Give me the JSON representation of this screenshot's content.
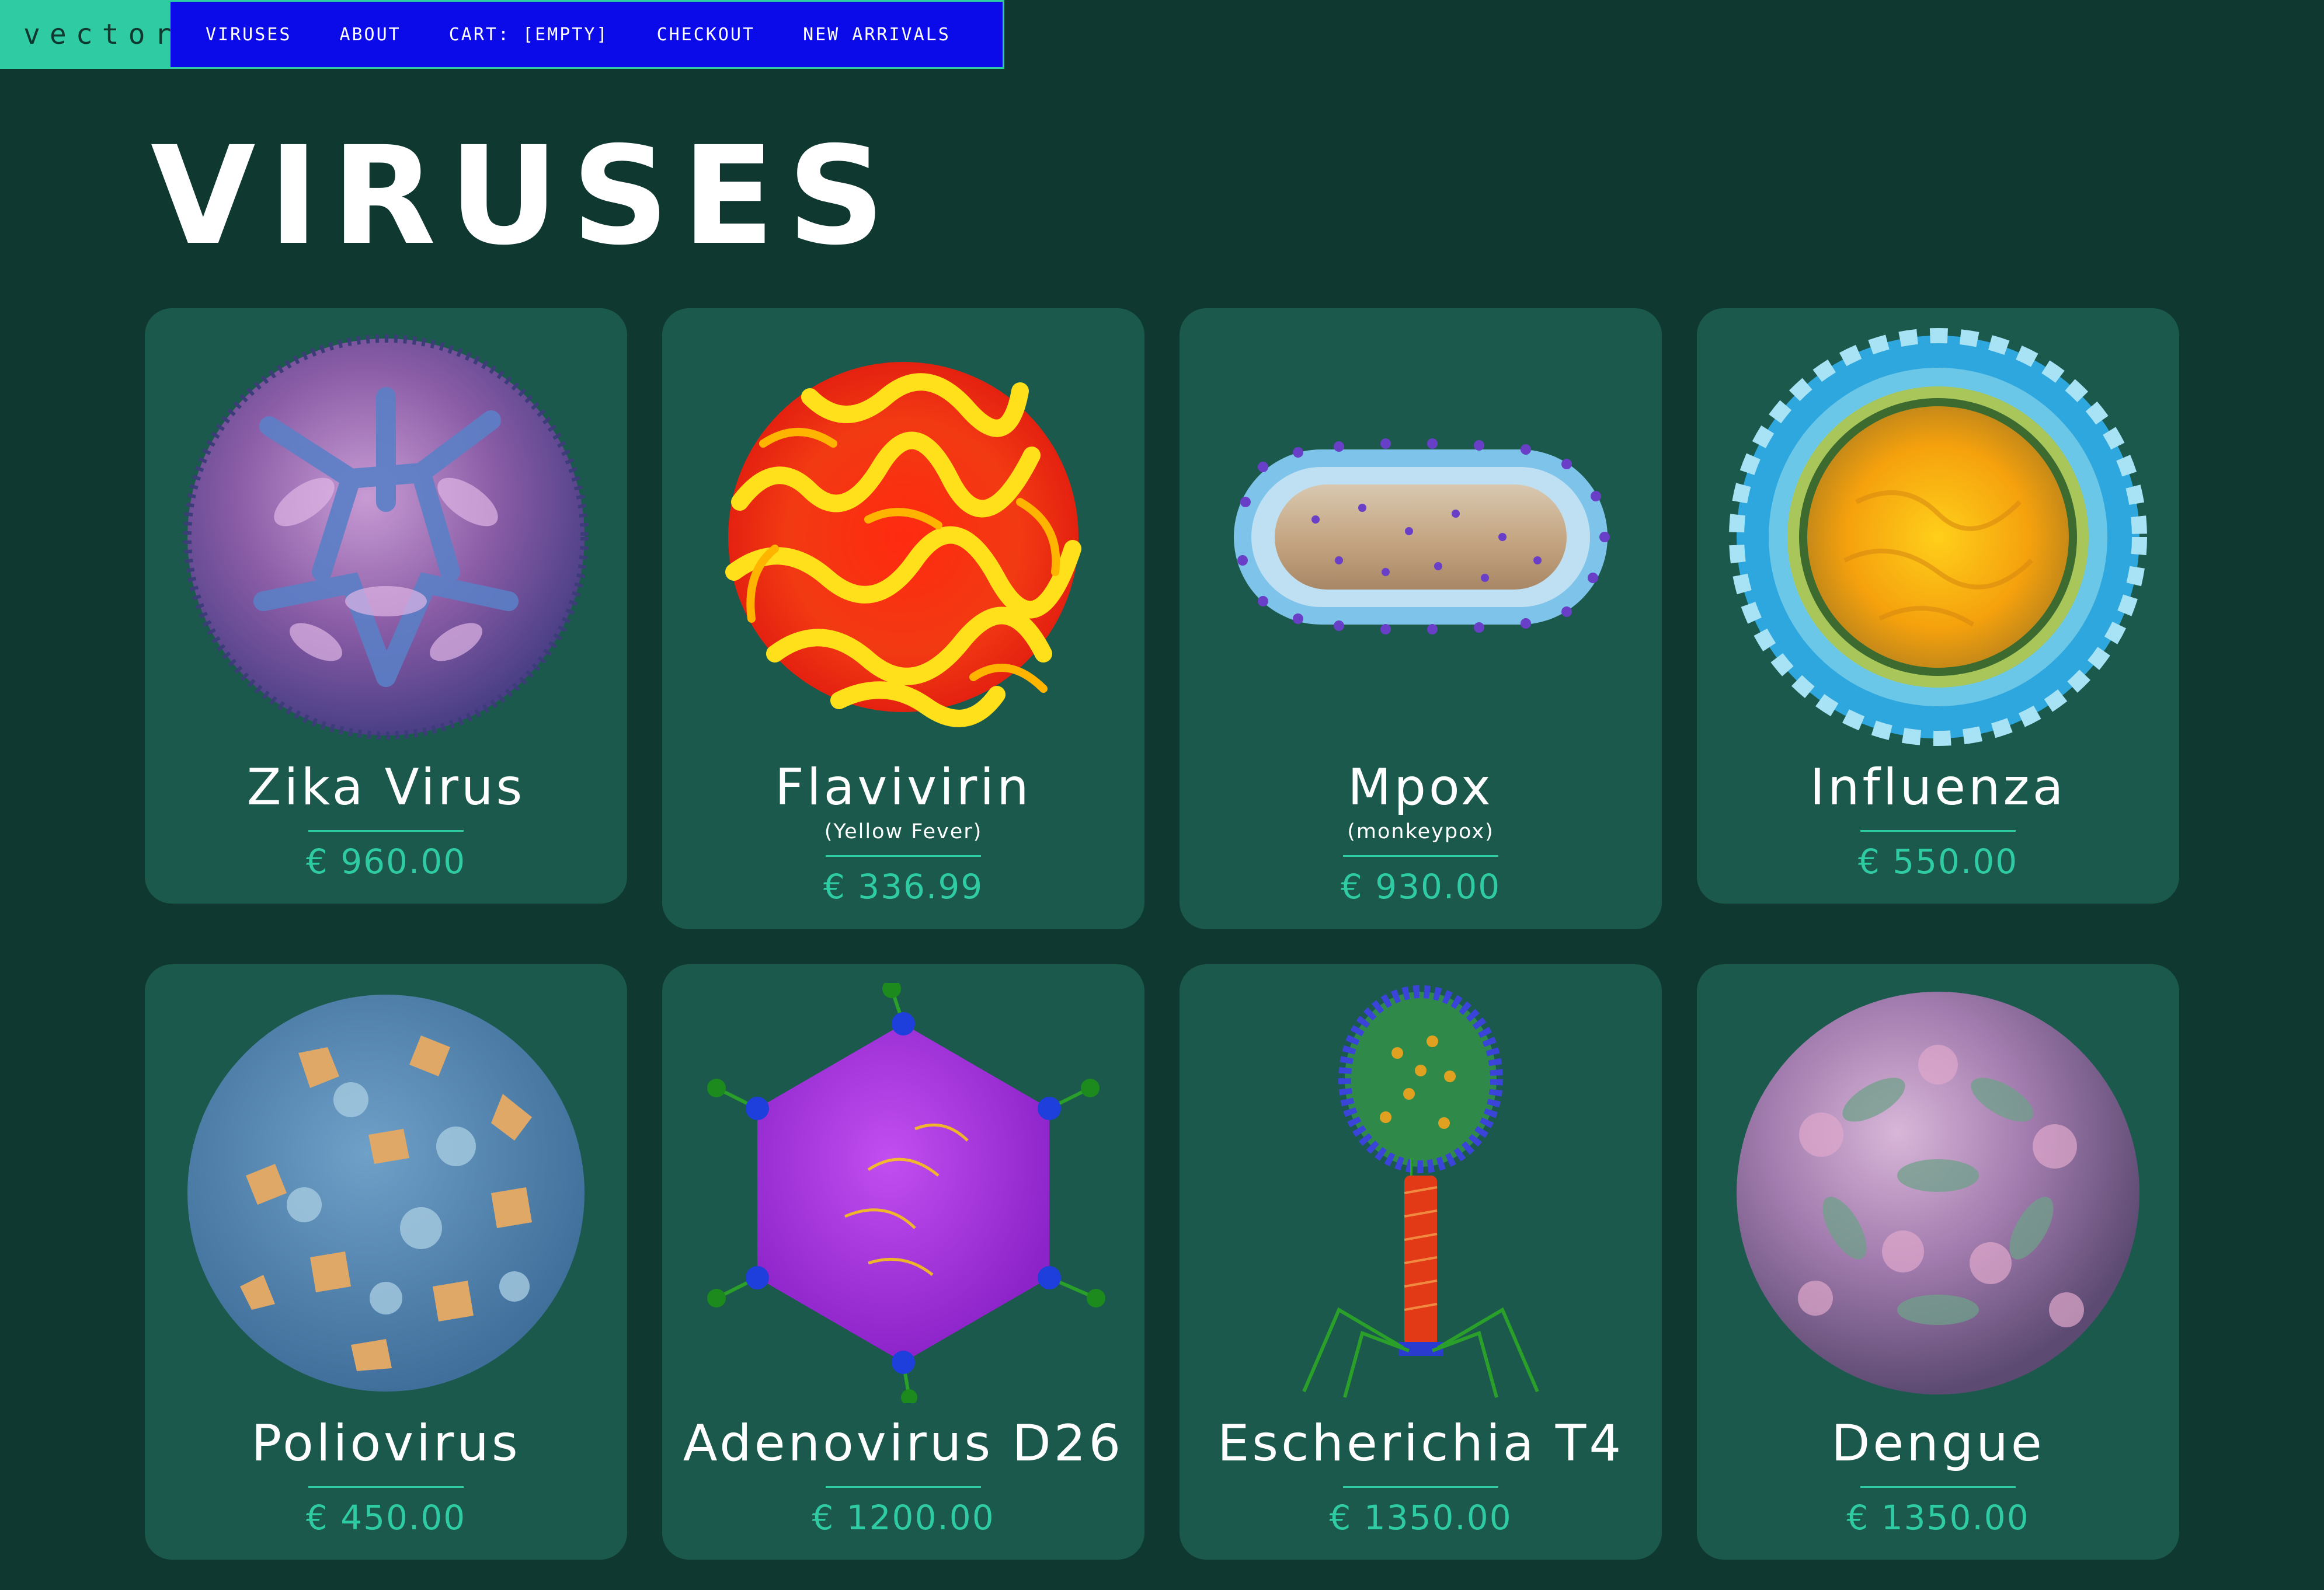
{
  "nav": {
    "logo": "vector",
    "links": [
      {
        "label": "VIRUSES"
      },
      {
        "label": "ABOUT"
      },
      {
        "label": "CART: [EMPTY]"
      },
      {
        "label": "CHECKOUT"
      },
      {
        "label": "NEW ARRIVALS"
      }
    ]
  },
  "page": {
    "title": "VIRUSES"
  },
  "products": [
    {
      "name": "Zika Virus",
      "subtitle": "",
      "price": "€ 960.00",
      "icon": "zika-virus-image"
    },
    {
      "name": "Flavivirin",
      "subtitle": "(Yellow Fever)",
      "price": "€ 336.99",
      "icon": "flavivirin-virus-image"
    },
    {
      "name": "Mpox",
      "subtitle": "(monkeypox)",
      "price": "€ 930.00",
      "icon": "mpox-virus-image"
    },
    {
      "name": "Influenza",
      "subtitle": "",
      "price": "€ 550.00",
      "icon": "influenza-virus-image"
    },
    {
      "name": "Poliovirus",
      "subtitle": "",
      "price": "€ 450.00",
      "icon": "poliovirus-image"
    },
    {
      "name": "Adenovirus D26",
      "subtitle": "",
      "price": "€ 1200.00",
      "icon": "adenovirus-image"
    },
    {
      "name": "Escherichia T4",
      "subtitle": "",
      "price": "€ 1350.00",
      "icon": "t4-phage-image"
    },
    {
      "name": "Dengue",
      "subtitle": "",
      "price": "€ 1350.00",
      "icon": "dengue-virus-image"
    }
  ],
  "colors": {
    "background": "#0f3830",
    "card": "#1b594c",
    "accent": "#2fcba3",
    "nav": "#0b0bea"
  }
}
